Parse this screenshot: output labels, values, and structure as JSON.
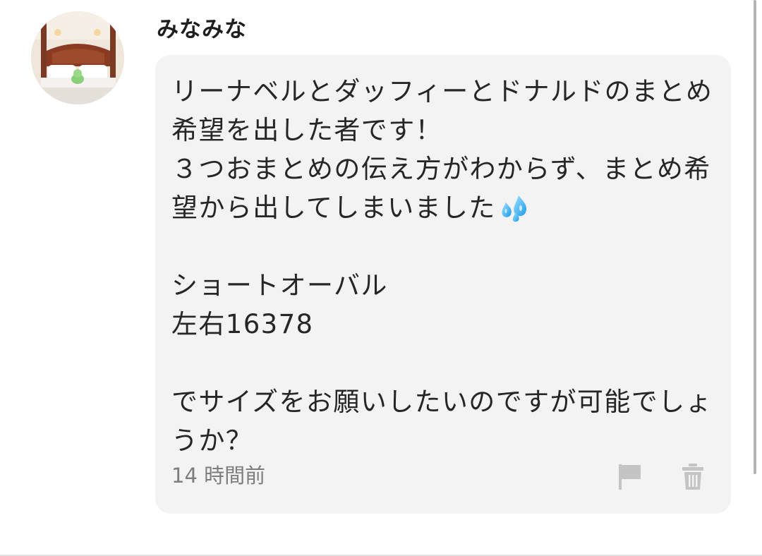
{
  "comment": {
    "username": "みなみな",
    "avatar_icon": "profile-photo-bedroom",
    "message_lines": [
      "リーナベルとダッフィーとドナルドのまとめ",
      "希望を出した者です！",
      "３つおまとめの伝え方がわからず、まとめ希",
      "望から出してしまいました",
      "",
      "ショートオーバル",
      "左右16378",
      "",
      "でサイズをお願いしたいのですが可能でしょ",
      "うか？"
    ],
    "emoji_icon": "sweat-droplets-icon",
    "timestamp": "14 時間前",
    "actions": {
      "flag_icon": "flag-icon",
      "delete_icon": "trash-icon"
    }
  },
  "colors": {
    "bubble_background": "#f3f3f3",
    "text": "#262626",
    "muted_text": "#7d7d7d",
    "icon_gray": "#c4c4c4"
  }
}
